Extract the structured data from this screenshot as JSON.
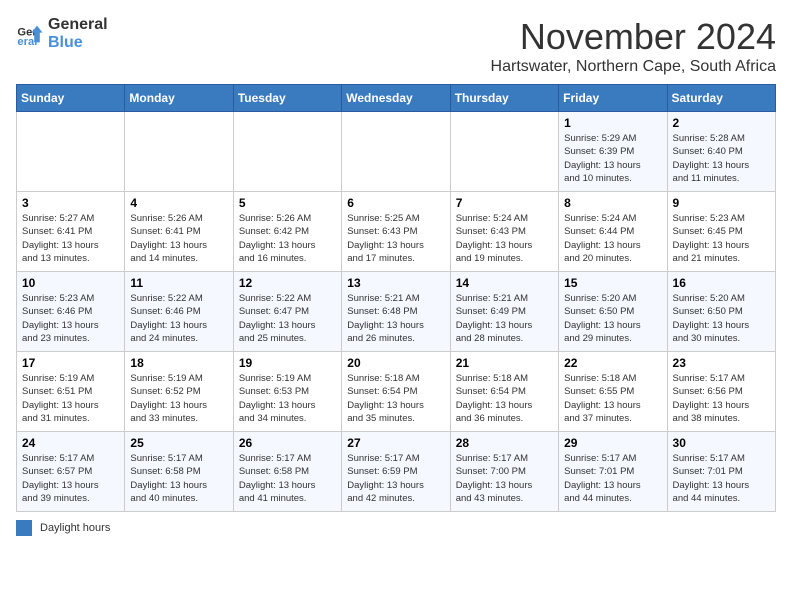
{
  "logo": {
    "line1": "General",
    "line2": "Blue"
  },
  "title": "November 2024",
  "subtitle": "Hartswater, Northern Cape, South Africa",
  "legend_label": "Daylight hours",
  "days_of_week": [
    "Sunday",
    "Monday",
    "Tuesday",
    "Wednesday",
    "Thursday",
    "Friday",
    "Saturday"
  ],
  "weeks": [
    [
      {
        "day": "",
        "info": ""
      },
      {
        "day": "",
        "info": ""
      },
      {
        "day": "",
        "info": ""
      },
      {
        "day": "",
        "info": ""
      },
      {
        "day": "",
        "info": ""
      },
      {
        "day": "1",
        "info": "Sunrise: 5:29 AM\nSunset: 6:39 PM\nDaylight: 13 hours\nand 10 minutes."
      },
      {
        "day": "2",
        "info": "Sunrise: 5:28 AM\nSunset: 6:40 PM\nDaylight: 13 hours\nand 11 minutes."
      }
    ],
    [
      {
        "day": "3",
        "info": "Sunrise: 5:27 AM\nSunset: 6:41 PM\nDaylight: 13 hours\nand 13 minutes."
      },
      {
        "day": "4",
        "info": "Sunrise: 5:26 AM\nSunset: 6:41 PM\nDaylight: 13 hours\nand 14 minutes."
      },
      {
        "day": "5",
        "info": "Sunrise: 5:26 AM\nSunset: 6:42 PM\nDaylight: 13 hours\nand 16 minutes."
      },
      {
        "day": "6",
        "info": "Sunrise: 5:25 AM\nSunset: 6:43 PM\nDaylight: 13 hours\nand 17 minutes."
      },
      {
        "day": "7",
        "info": "Sunrise: 5:24 AM\nSunset: 6:43 PM\nDaylight: 13 hours\nand 19 minutes."
      },
      {
        "day": "8",
        "info": "Sunrise: 5:24 AM\nSunset: 6:44 PM\nDaylight: 13 hours\nand 20 minutes."
      },
      {
        "day": "9",
        "info": "Sunrise: 5:23 AM\nSunset: 6:45 PM\nDaylight: 13 hours\nand 21 minutes."
      }
    ],
    [
      {
        "day": "10",
        "info": "Sunrise: 5:23 AM\nSunset: 6:46 PM\nDaylight: 13 hours\nand 23 minutes."
      },
      {
        "day": "11",
        "info": "Sunrise: 5:22 AM\nSunset: 6:46 PM\nDaylight: 13 hours\nand 24 minutes."
      },
      {
        "day": "12",
        "info": "Sunrise: 5:22 AM\nSunset: 6:47 PM\nDaylight: 13 hours\nand 25 minutes."
      },
      {
        "day": "13",
        "info": "Sunrise: 5:21 AM\nSunset: 6:48 PM\nDaylight: 13 hours\nand 26 minutes."
      },
      {
        "day": "14",
        "info": "Sunrise: 5:21 AM\nSunset: 6:49 PM\nDaylight: 13 hours\nand 28 minutes."
      },
      {
        "day": "15",
        "info": "Sunrise: 5:20 AM\nSunset: 6:50 PM\nDaylight: 13 hours\nand 29 minutes."
      },
      {
        "day": "16",
        "info": "Sunrise: 5:20 AM\nSunset: 6:50 PM\nDaylight: 13 hours\nand 30 minutes."
      }
    ],
    [
      {
        "day": "17",
        "info": "Sunrise: 5:19 AM\nSunset: 6:51 PM\nDaylight: 13 hours\nand 31 minutes."
      },
      {
        "day": "18",
        "info": "Sunrise: 5:19 AM\nSunset: 6:52 PM\nDaylight: 13 hours\nand 33 minutes."
      },
      {
        "day": "19",
        "info": "Sunrise: 5:19 AM\nSunset: 6:53 PM\nDaylight: 13 hours\nand 34 minutes."
      },
      {
        "day": "20",
        "info": "Sunrise: 5:18 AM\nSunset: 6:54 PM\nDaylight: 13 hours\nand 35 minutes."
      },
      {
        "day": "21",
        "info": "Sunrise: 5:18 AM\nSunset: 6:54 PM\nDaylight: 13 hours\nand 36 minutes."
      },
      {
        "day": "22",
        "info": "Sunrise: 5:18 AM\nSunset: 6:55 PM\nDaylight: 13 hours\nand 37 minutes."
      },
      {
        "day": "23",
        "info": "Sunrise: 5:17 AM\nSunset: 6:56 PM\nDaylight: 13 hours\nand 38 minutes."
      }
    ],
    [
      {
        "day": "24",
        "info": "Sunrise: 5:17 AM\nSunset: 6:57 PM\nDaylight: 13 hours\nand 39 minutes."
      },
      {
        "day": "25",
        "info": "Sunrise: 5:17 AM\nSunset: 6:58 PM\nDaylight: 13 hours\nand 40 minutes."
      },
      {
        "day": "26",
        "info": "Sunrise: 5:17 AM\nSunset: 6:58 PM\nDaylight: 13 hours\nand 41 minutes."
      },
      {
        "day": "27",
        "info": "Sunrise: 5:17 AM\nSunset: 6:59 PM\nDaylight: 13 hours\nand 42 minutes."
      },
      {
        "day": "28",
        "info": "Sunrise: 5:17 AM\nSunset: 7:00 PM\nDaylight: 13 hours\nand 43 minutes."
      },
      {
        "day": "29",
        "info": "Sunrise: 5:17 AM\nSunset: 7:01 PM\nDaylight: 13 hours\nand 44 minutes."
      },
      {
        "day": "30",
        "info": "Sunrise: 5:17 AM\nSunset: 7:01 PM\nDaylight: 13 hours\nand 44 minutes."
      }
    ]
  ]
}
